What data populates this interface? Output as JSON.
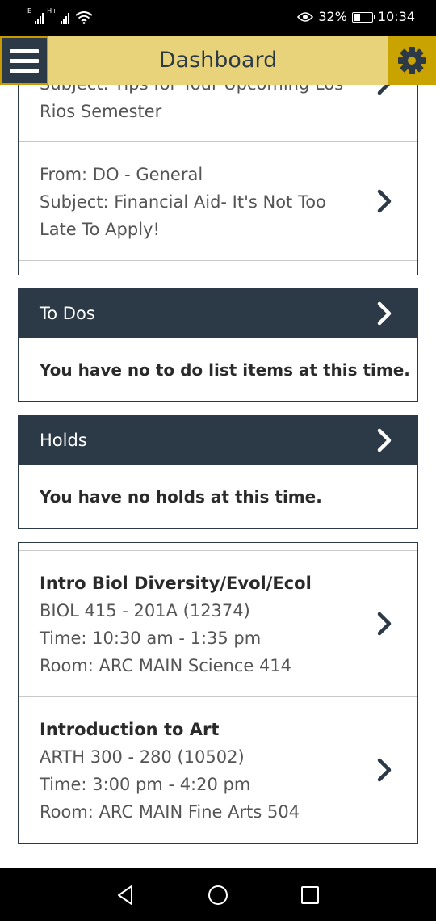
{
  "status_bar": {
    "network_label_1": "E",
    "network_label_2": "H+",
    "battery_percent": "32%",
    "time": "10:34"
  },
  "header": {
    "title": "Dashboard"
  },
  "messages": [
    {
      "from": "",
      "subject_partial_line": "Subject: Tips for Your Upcoming Los",
      "subject_line_2": "Rios Semester"
    },
    {
      "from": "From: DO - General",
      "subject_line_1": "Subject: Financial Aid- It's Not Too",
      "subject_line_2": "Late To Apply!"
    }
  ],
  "todos": {
    "heading": "To Dos",
    "empty_text": "You have no to do list items at this time."
  },
  "holds": {
    "heading": "Holds",
    "empty_text": "You have no holds at this time."
  },
  "classes": [
    {
      "title": "Intro Biol Diversity/Evol/Ecol",
      "code": "BIOL 415 - 201A (12374)",
      "time": "Time: 10:30 am - 1:35 pm",
      "room": "Room: ARC MAIN Science 414"
    },
    {
      "title": "Introduction to Art",
      "code": "ARTH 300 - 280 (10502)",
      "time": "Time: 3:00 pm - 4:20 pm",
      "room": "Room: ARC MAIN Fine Arts 504"
    }
  ],
  "icons": {
    "menu": "hamburger-menu-icon",
    "settings": "gear-icon",
    "chevron": "chevron-right-icon",
    "back": "triangle-back-icon",
    "home": "circle-home-icon",
    "recents": "square-recents-icon"
  },
  "colors": {
    "header_bg": "#e8d37a",
    "gear_bg": "#c9a300",
    "dark_navy": "#2c3a47"
  }
}
